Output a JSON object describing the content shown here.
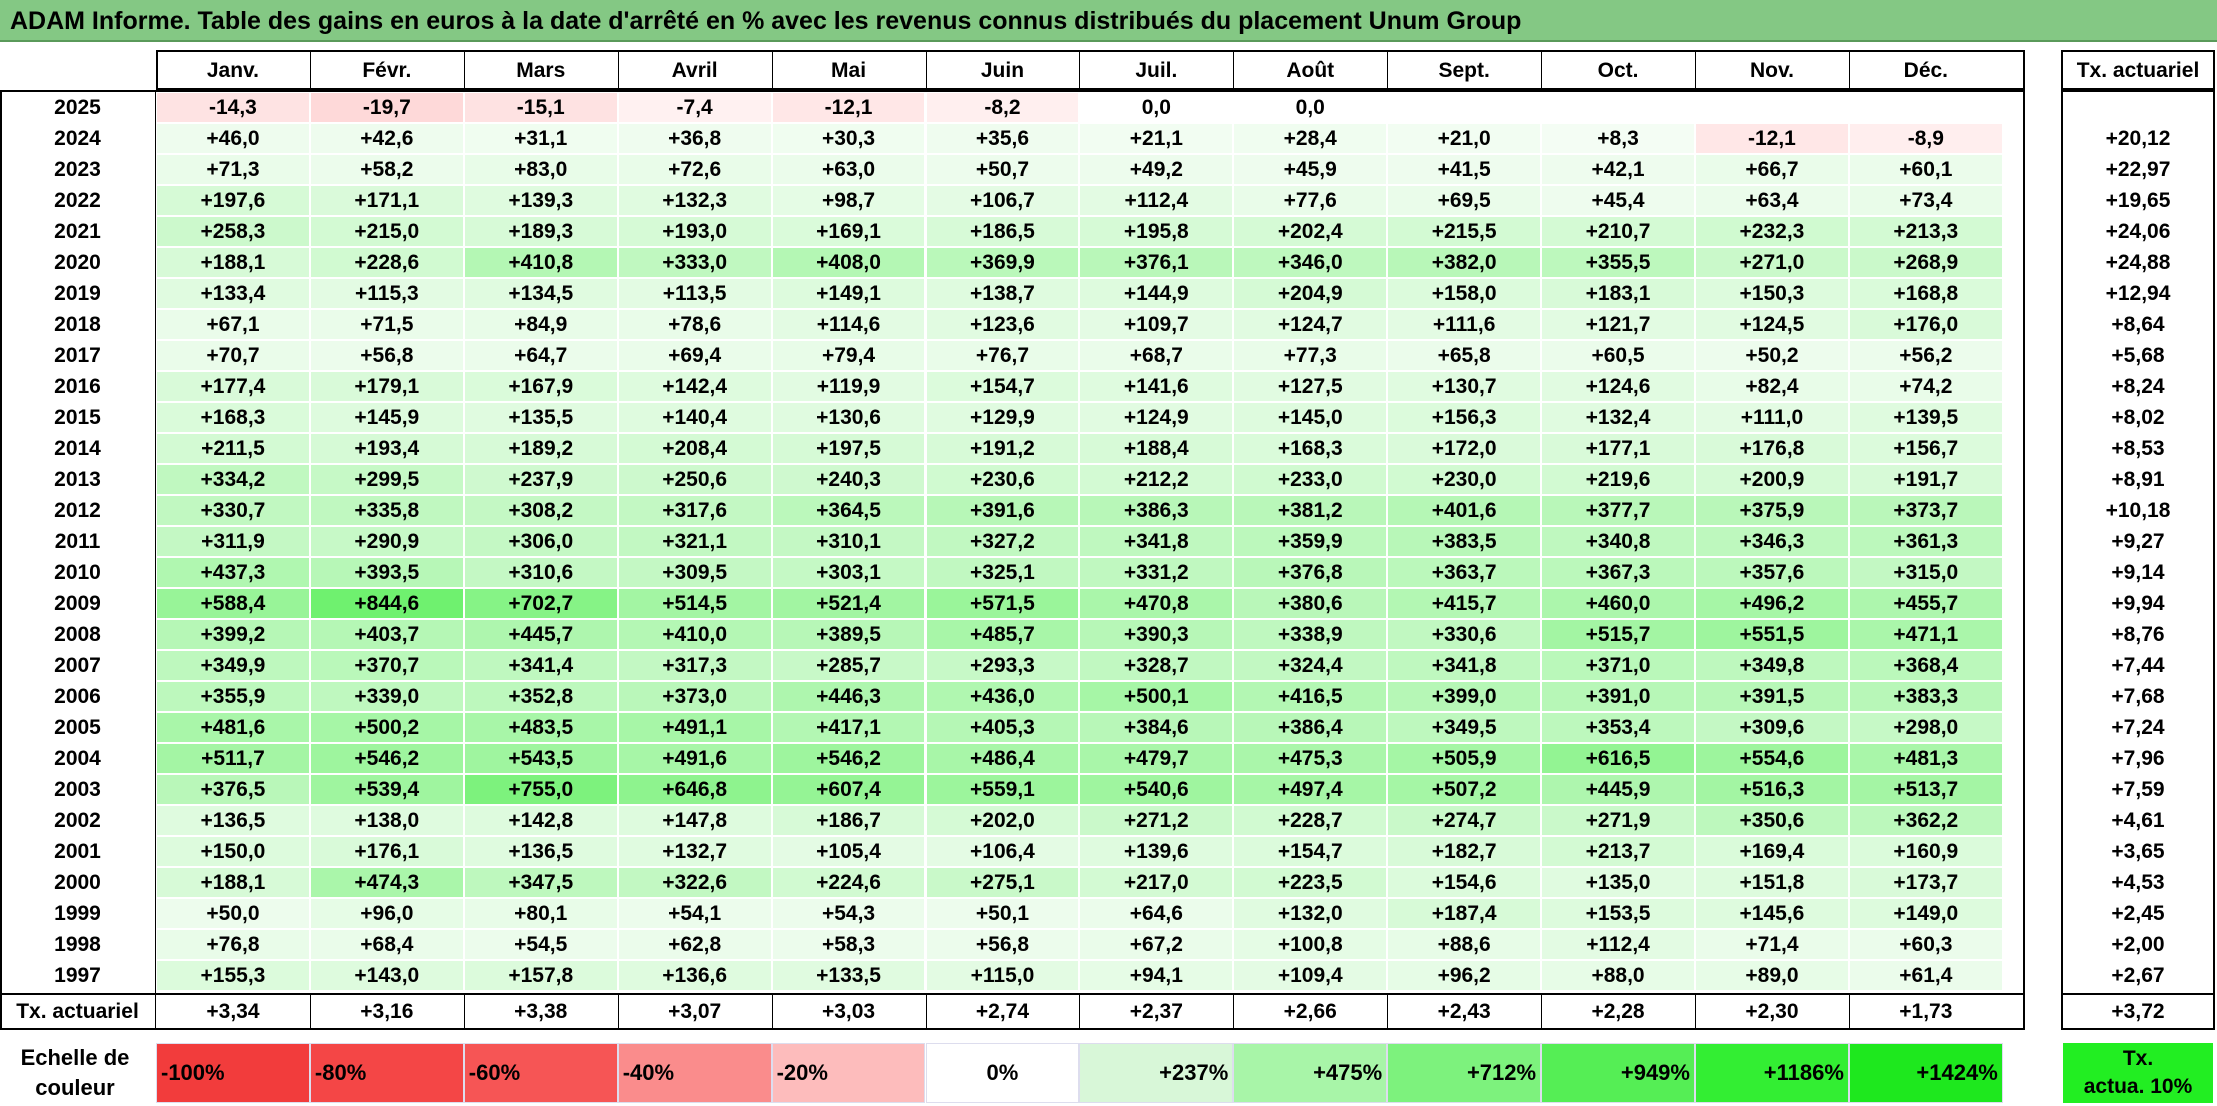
{
  "title": "ADAM Informe. Table des gains en euros à la date d'arrêté en % avec les revenus connus distribués du placement Unum Group",
  "months": [
    "Janv.",
    "Févr.",
    "Mars",
    "Avril",
    "Mai",
    "Juin",
    "Juil.",
    "Août",
    "Sept.",
    "Oct.",
    "Nov.",
    "Déc."
  ],
  "rate_header": "Tx. actuariel",
  "rows": [
    {
      "year": "2025",
      "values": [
        "-14,3",
        "-19,7",
        "-15,1",
        "-7,4",
        "-12,1",
        "-8,2",
        "0,0",
        "0,0",
        "",
        "",
        "",
        ""
      ],
      "rate": ""
    },
    {
      "year": "2024",
      "values": [
        "+46,0",
        "+42,6",
        "+31,1",
        "+36,8",
        "+30,3",
        "+35,6",
        "+21,1",
        "+28,4",
        "+21,0",
        "+8,3",
        "-12,1",
        "-8,9"
      ],
      "rate": "+20,12"
    },
    {
      "year": "2023",
      "values": [
        "+71,3",
        "+58,2",
        "+83,0",
        "+72,6",
        "+63,0",
        "+50,7",
        "+49,2",
        "+45,9",
        "+41,5",
        "+42,1",
        "+66,7",
        "+60,1"
      ],
      "rate": "+22,97"
    },
    {
      "year": "2022",
      "values": [
        "+197,6",
        "+171,1",
        "+139,3",
        "+132,3",
        "+98,7",
        "+106,7",
        "+112,4",
        "+77,6",
        "+69,5",
        "+45,4",
        "+63,4",
        "+73,4"
      ],
      "rate": "+19,65"
    },
    {
      "year": "2021",
      "values": [
        "+258,3",
        "+215,0",
        "+189,3",
        "+193,0",
        "+169,1",
        "+186,5",
        "+195,8",
        "+202,4",
        "+215,5",
        "+210,7",
        "+232,3",
        "+213,3"
      ],
      "rate": "+24,06"
    },
    {
      "year": "2020",
      "values": [
        "+188,1",
        "+228,6",
        "+410,8",
        "+333,0",
        "+408,0",
        "+369,9",
        "+376,1",
        "+346,0",
        "+382,0",
        "+355,5",
        "+271,0",
        "+268,9"
      ],
      "rate": "+24,88"
    },
    {
      "year": "2019",
      "values": [
        "+133,4",
        "+115,3",
        "+134,5",
        "+113,5",
        "+149,1",
        "+138,7",
        "+144,9",
        "+204,9",
        "+158,0",
        "+183,1",
        "+150,3",
        "+168,8"
      ],
      "rate": "+12,94"
    },
    {
      "year": "2018",
      "values": [
        "+67,1",
        "+71,5",
        "+84,9",
        "+78,6",
        "+114,6",
        "+123,6",
        "+109,7",
        "+124,7",
        "+111,6",
        "+121,7",
        "+124,5",
        "+176,0"
      ],
      "rate": "+8,64"
    },
    {
      "year": "2017",
      "values": [
        "+70,7",
        "+56,8",
        "+64,7",
        "+69,4",
        "+79,4",
        "+76,7",
        "+68,7",
        "+77,3",
        "+65,8",
        "+60,5",
        "+50,2",
        "+56,2"
      ],
      "rate": "+5,68"
    },
    {
      "year": "2016",
      "values": [
        "+177,4",
        "+179,1",
        "+167,9",
        "+142,4",
        "+119,9",
        "+154,7",
        "+141,6",
        "+127,5",
        "+130,7",
        "+124,6",
        "+82,4",
        "+74,2"
      ],
      "rate": "+8,24"
    },
    {
      "year": "2015",
      "values": [
        "+168,3",
        "+145,9",
        "+135,5",
        "+140,4",
        "+130,6",
        "+129,9",
        "+124,9",
        "+145,0",
        "+156,3",
        "+132,4",
        "+111,0",
        "+139,5"
      ],
      "rate": "+8,02"
    },
    {
      "year": "2014",
      "values": [
        "+211,5",
        "+193,4",
        "+189,2",
        "+208,4",
        "+197,5",
        "+191,2",
        "+188,4",
        "+168,3",
        "+172,0",
        "+177,1",
        "+176,8",
        "+156,7"
      ],
      "rate": "+8,53"
    },
    {
      "year": "2013",
      "values": [
        "+334,2",
        "+299,5",
        "+237,9",
        "+250,6",
        "+240,3",
        "+230,6",
        "+212,2",
        "+233,0",
        "+230,0",
        "+219,6",
        "+200,9",
        "+191,7"
      ],
      "rate": "+8,91"
    },
    {
      "year": "2012",
      "values": [
        "+330,7",
        "+335,8",
        "+308,2",
        "+317,6",
        "+364,5",
        "+391,6",
        "+386,3",
        "+381,2",
        "+401,6",
        "+377,7",
        "+375,9",
        "+373,7"
      ],
      "rate": "+10,18"
    },
    {
      "year": "2011",
      "values": [
        "+311,9",
        "+290,9",
        "+306,0",
        "+321,1",
        "+310,1",
        "+327,2",
        "+341,8",
        "+359,9",
        "+383,5",
        "+340,8",
        "+346,3",
        "+361,3"
      ],
      "rate": "+9,27"
    },
    {
      "year": "2010",
      "values": [
        "+437,3",
        "+393,5",
        "+310,6",
        "+309,5",
        "+303,1",
        "+325,1",
        "+331,2",
        "+376,8",
        "+363,7",
        "+367,3",
        "+357,6",
        "+315,0"
      ],
      "rate": "+9,14"
    },
    {
      "year": "2009",
      "values": [
        "+588,4",
        "+844,6",
        "+702,7",
        "+514,5",
        "+521,4",
        "+571,5",
        "+470,8",
        "+380,6",
        "+415,7",
        "+460,0",
        "+496,2",
        "+455,7"
      ],
      "rate": "+9,94"
    },
    {
      "year": "2008",
      "values": [
        "+399,2",
        "+403,7",
        "+445,7",
        "+410,0",
        "+389,5",
        "+485,7",
        "+390,3",
        "+338,9",
        "+330,6",
        "+515,7",
        "+551,5",
        "+471,1"
      ],
      "rate": "+8,76"
    },
    {
      "year": "2007",
      "values": [
        "+349,9",
        "+370,7",
        "+341,4",
        "+317,3",
        "+285,7",
        "+293,3",
        "+328,7",
        "+324,4",
        "+341,8",
        "+371,0",
        "+349,8",
        "+368,4"
      ],
      "rate": "+7,44"
    },
    {
      "year": "2006",
      "values": [
        "+355,9",
        "+339,0",
        "+352,8",
        "+373,0",
        "+446,3",
        "+436,0",
        "+500,1",
        "+416,5",
        "+399,0",
        "+391,0",
        "+391,5",
        "+383,3"
      ],
      "rate": "+7,68"
    },
    {
      "year": "2005",
      "values": [
        "+481,6",
        "+500,2",
        "+483,5",
        "+491,1",
        "+417,1",
        "+405,3",
        "+384,6",
        "+386,4",
        "+349,5",
        "+353,4",
        "+309,6",
        "+298,0"
      ],
      "rate": "+7,24"
    },
    {
      "year": "2004",
      "values": [
        "+511,7",
        "+546,2",
        "+543,5",
        "+491,6",
        "+546,2",
        "+486,4",
        "+479,7",
        "+475,3",
        "+505,9",
        "+616,5",
        "+554,6",
        "+481,3"
      ],
      "rate": "+7,96"
    },
    {
      "year": "2003",
      "values": [
        "+376,5",
        "+539,4",
        "+755,0",
        "+646,8",
        "+607,4",
        "+559,1",
        "+540,6",
        "+497,4",
        "+507,2",
        "+445,9",
        "+516,3",
        "+513,7"
      ],
      "rate": "+7,59"
    },
    {
      "year": "2002",
      "values": [
        "+136,5",
        "+138,0",
        "+142,8",
        "+147,8",
        "+186,7",
        "+202,0",
        "+271,2",
        "+228,7",
        "+274,7",
        "+271,9",
        "+350,6",
        "+362,2"
      ],
      "rate": "+4,61"
    },
    {
      "year": "2001",
      "values": [
        "+150,0",
        "+176,1",
        "+136,5",
        "+132,7",
        "+105,4",
        "+106,4",
        "+139,6",
        "+154,7",
        "+182,7",
        "+213,7",
        "+169,4",
        "+160,9"
      ],
      "rate": "+3,65"
    },
    {
      "year": "2000",
      "values": [
        "+188,1",
        "+474,3",
        "+347,5",
        "+322,6",
        "+224,6",
        "+275,1",
        "+217,0",
        "+223,5",
        "+154,6",
        "+135,0",
        "+151,8",
        "+173,7"
      ],
      "rate": "+4,53"
    },
    {
      "year": "1999",
      "values": [
        "+50,0",
        "+96,0",
        "+80,1",
        "+54,1",
        "+54,3",
        "+50,1",
        "+64,6",
        "+132,0",
        "+187,4",
        "+153,5",
        "+145,6",
        "+149,0"
      ],
      "rate": "+2,45"
    },
    {
      "year": "1998",
      "values": [
        "+76,8",
        "+68,4",
        "+54,5",
        "+62,8",
        "+58,3",
        "+56,8",
        "+67,2",
        "+100,8",
        "+88,6",
        "+112,4",
        "+71,4",
        "+60,3"
      ],
      "rate": "+2,00"
    },
    {
      "year": "1997",
      "values": [
        "+155,3",
        "+143,0",
        "+157,8",
        "+136,6",
        "+133,5",
        "+115,0",
        "+94,1",
        "+109,4",
        "+96,2",
        "+88,0",
        "+89,0",
        "+61,4"
      ],
      "rate": "+2,67"
    }
  ],
  "totals": {
    "label": "Tx. actuariel",
    "values": [
      "+3,34",
      "+3,16",
      "+3,38",
      "+3,07",
      "+3,03",
      "+2,74",
      "+2,37",
      "+2,66",
      "+2,43",
      "+2,28",
      "+2,30",
      "+1,73"
    ],
    "rate": "+3,72"
  },
  "legend": {
    "label_line1": "Echelle de",
    "label_line2": "couleur",
    "items": [
      {
        "label": "-100%",
        "color": "#f23c3c",
        "align": "left"
      },
      {
        "label": "-80%",
        "color": "#f44646",
        "align": "left"
      },
      {
        "label": "-60%",
        "color": "#f65555",
        "align": "left"
      },
      {
        "label": "-40%",
        "color": "#fa8c8c",
        "align": "left"
      },
      {
        "label": "-20%",
        "color": "#fdbcbc",
        "align": "left"
      },
      {
        "label": "0%",
        "color": "#ffffff",
        "align": "center"
      },
      {
        "label": "+237%",
        "color": "#d8f7d8",
        "align": "right"
      },
      {
        "label": "+475%",
        "color": "#a8f5a8",
        "align": "right"
      },
      {
        "label": "+712%",
        "color": "#7df27d",
        "align": "right"
      },
      {
        "label": "+949%",
        "color": "#55ee55",
        "align": "right"
      },
      {
        "label": "+1186%",
        "color": "#33ee33",
        "align": "right"
      },
      {
        "label": "+1424%",
        "color": "#1ee81e",
        "align": "right"
      }
    ],
    "actua_line1": "Tx.",
    "actua_line2": "actua. 10%",
    "actua_color": "#22ee22"
  }
}
